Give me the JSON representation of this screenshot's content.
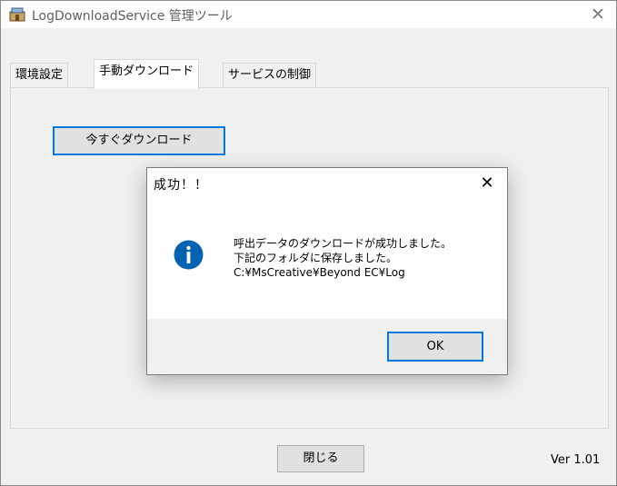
{
  "window": {
    "title": "LogDownloadService 管理ツール",
    "close_glyph": "✕",
    "app_icon": "app-icon"
  },
  "tabs": [
    {
      "label": "環境設定",
      "active": false
    },
    {
      "label": "手動ダウンロード",
      "active": true
    },
    {
      "label": "サービスの制御",
      "active": false
    }
  ],
  "main": {
    "download_button_label": "今すぐダウンロード",
    "close_button_label": "閉じる",
    "version": "Ver 1.01"
  },
  "dialog": {
    "title": "成功！！",
    "close_glyph": "✕",
    "icon": "info-icon",
    "message_lines": [
      "呼出データのダウンロードが成功しました。",
      "下記のフォルダに保存しました。",
      "C:¥MsCreative¥Beyond EC¥Log"
    ],
    "ok_label": "OK"
  },
  "colors": {
    "accent": "#0078d7",
    "info_icon": "#0063b1",
    "window_bg": "#f0f0f0",
    "button_bg": "#e1e1e1"
  }
}
